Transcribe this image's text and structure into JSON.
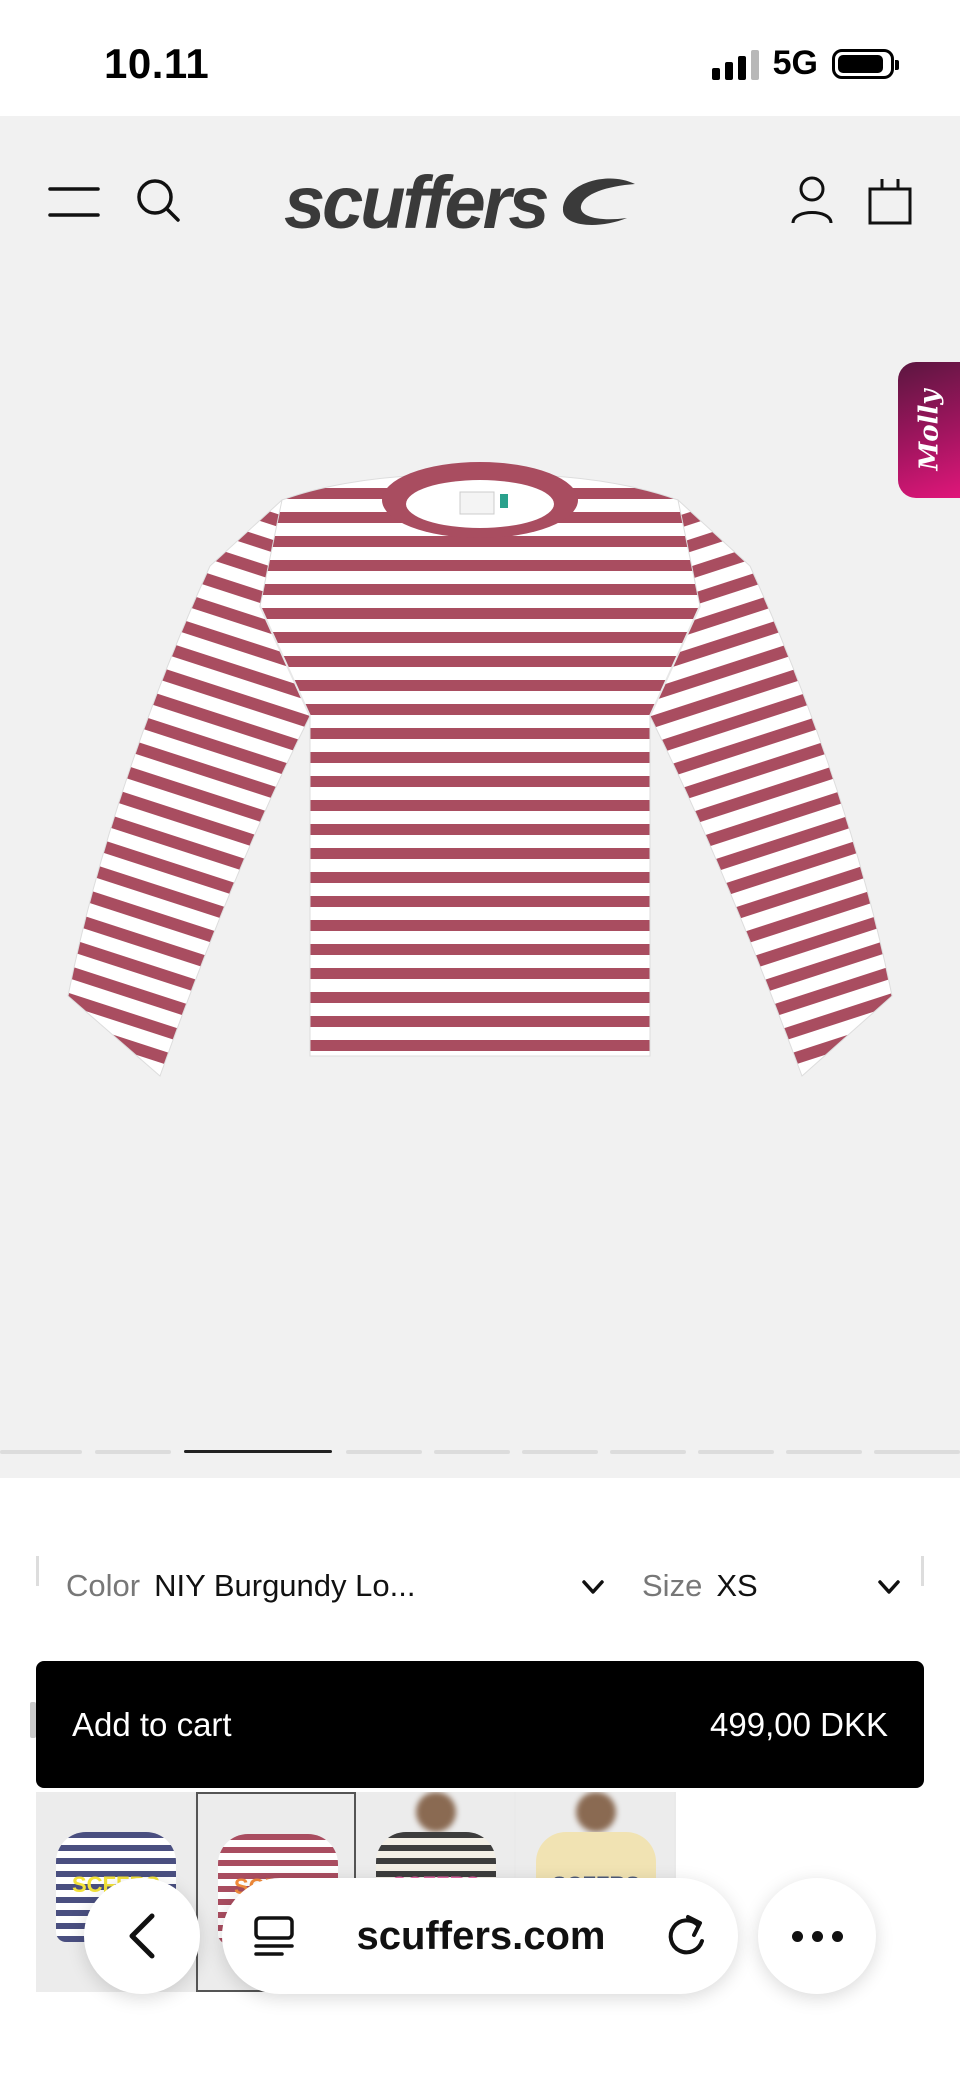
{
  "status_bar": {
    "time": "10.11",
    "network": "5G",
    "signal_bars_active": 3,
    "signal_bars_total": 4,
    "battery_level": 0.9
  },
  "header": {
    "logo_text": "scuffers",
    "icons": [
      "menu-icon",
      "search-icon",
      "account-icon",
      "cart-icon"
    ]
  },
  "side_tab": {
    "label": "Molly"
  },
  "gallery": {
    "image_count": 11,
    "active_index": 2,
    "stripe_color": "#a94d60",
    "background": "#f1f1f1"
  },
  "selectors": {
    "color_label": "Color",
    "color_value": "NIY Burgundy Lo...",
    "size_label": "Size",
    "size_value": "XS"
  },
  "cart": {
    "label": "Add to cart",
    "price": "499,00 DKK"
  },
  "thumbnails": [
    {
      "text": "SCFFRS"
    },
    {
      "text": "SCFFRS"
    },
    {
      "text": "SCFFRS"
    },
    {
      "text": "SCFFRS"
    }
  ],
  "browser": {
    "url": "scuffers.com"
  }
}
